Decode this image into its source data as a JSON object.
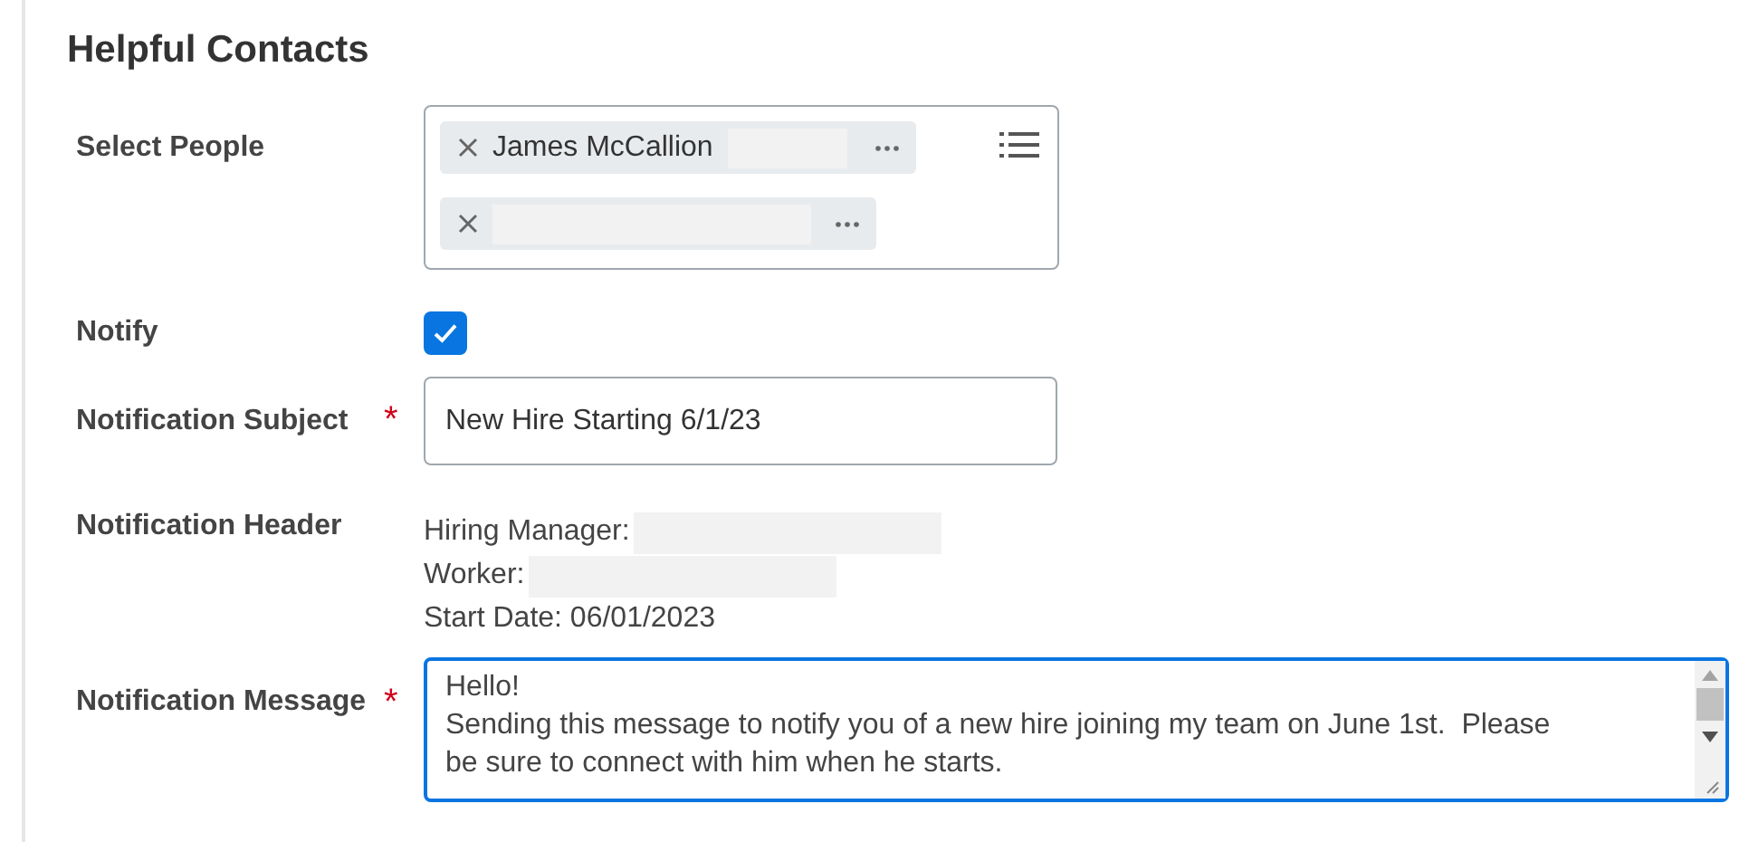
{
  "section": {
    "title": "Helpful Contacts"
  },
  "required_mark": "*",
  "select_people": {
    "label": "Select People",
    "required": false,
    "tags": [
      {
        "name": "James McCallion",
        "redacted": true
      },
      {
        "redacted": true
      }
    ]
  },
  "notify": {
    "label": "Notify",
    "required": false,
    "checked": true
  },
  "subject": {
    "label": "Notification Subject",
    "required": true,
    "value": "New Hire Starting 6/1/23"
  },
  "header": {
    "label": "Notification Header",
    "required": false,
    "lines": [
      {
        "text": "Hiring Manager:",
        "redacted": true
      },
      {
        "text": "Worker:",
        "redacted": true
      },
      {
        "text": "Start Date: 06/01/2023",
        "redacted": false
      }
    ]
  },
  "message": {
    "label": "Notification Message",
    "required": true,
    "focused": true,
    "lines": [
      "Hello!",
      "Sending this message to notify you of a new hire joining my team on June 1st.  Please",
      "be sure to connect with him when he starts."
    ]
  }
}
